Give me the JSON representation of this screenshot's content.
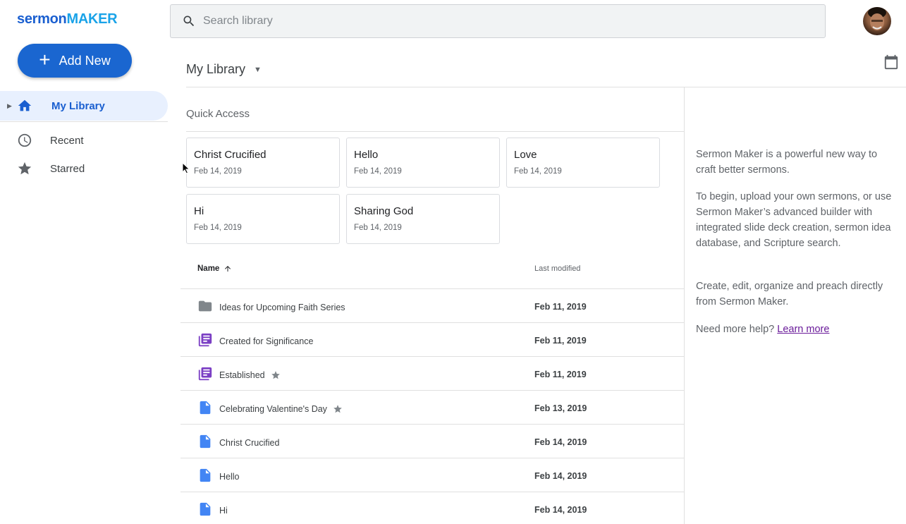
{
  "brand": {
    "part1": "sermon",
    "part2": "MAKER"
  },
  "search": {
    "placeholder": "Search library"
  },
  "sidebar": {
    "add_label": "Add New",
    "items": [
      {
        "label": "My Library",
        "icon": "home-icon"
      },
      {
        "label": "Recent",
        "icon": "clock-icon"
      },
      {
        "label": "Starred",
        "icon": "star-icon"
      }
    ]
  },
  "main": {
    "library_title": "My Library",
    "quick_access_title": "Quick Access",
    "quick_access": [
      {
        "title": "Christ Crucified",
        "date": "Feb 14, 2019"
      },
      {
        "title": "Hello",
        "date": "Feb 14, 2019"
      },
      {
        "title": "Love",
        "date": "Feb 14, 2019"
      },
      {
        "title": "Hi",
        "date": "Feb 14, 2019"
      },
      {
        "title": "Sharing God",
        "date": "Feb 14, 2019"
      }
    ],
    "table": {
      "col_name": "Name",
      "col_modified": "Last modified",
      "rows": [
        {
          "name": "Ideas for Upcoming Faith Series",
          "modified": "Feb 11, 2019",
          "type": "folder",
          "starred": false
        },
        {
          "name": "Created for Significance",
          "modified": "Feb 11, 2019",
          "type": "series",
          "starred": false
        },
        {
          "name": "Established",
          "modified": "Feb 11, 2019",
          "type": "series",
          "starred": true
        },
        {
          "name": "Celebrating Valentine's Day",
          "modified": "Feb 13, 2019",
          "type": "doc",
          "starred": true
        },
        {
          "name": "Christ Crucified",
          "modified": "Feb 14, 2019",
          "type": "doc",
          "starred": false
        },
        {
          "name": "Hello",
          "modified": "Feb 14, 2019",
          "type": "doc",
          "starred": false
        },
        {
          "name": "Hi",
          "modified": "Feb 14, 2019",
          "type": "doc",
          "starred": false
        }
      ]
    }
  },
  "info_panel": {
    "p1": "Sermon Maker is a powerful new way to craft better sermons.",
    "p2": "To begin, upload your own sermons, or use Sermon Maker’s advanced builder with integrated slide deck creation, sermon idea database, and Scripture search.",
    "p3": "Create, edit, organize and preach directly from Sermon Maker.",
    "help_prefix": "Need more help?",
    "help_link": "Learn more"
  },
  "colors": {
    "brand_blue": "#1a66d0",
    "brand_light": "#1aa3e8",
    "folder_gray": "#80868b",
    "series_purple": "#7b3fc4",
    "doc_blue": "#4285f4",
    "link_purple": "#6a1b9a"
  }
}
